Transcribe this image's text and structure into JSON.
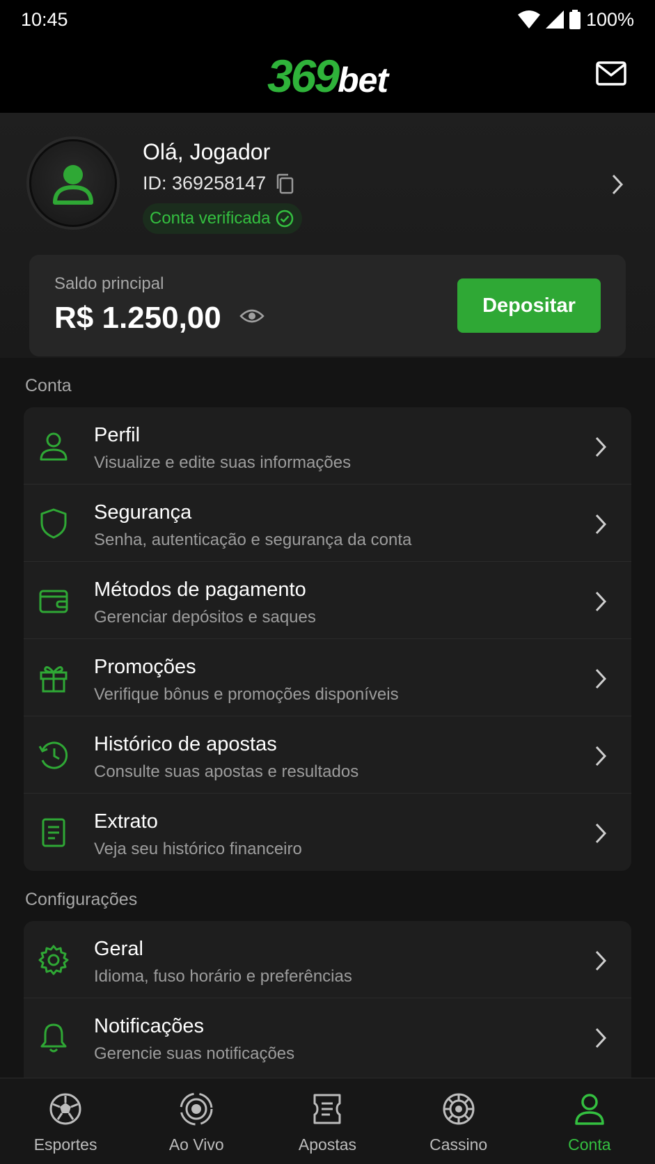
{
  "status_bar": {
    "time": "10:45",
    "battery": "100%"
  },
  "header": {
    "logo_number": "369",
    "logo_word": "bet",
    "icon": "mail-icon"
  },
  "profile": {
    "greeting": "Olá, Jogador",
    "user_id": "ID: 369258147",
    "verified": "Conta verificada"
  },
  "balance": {
    "label": "Saldo principal",
    "value": "R$ 1.250,00",
    "deposit_label": "Depositar"
  },
  "sections": {
    "account_title": "Conta",
    "settings_title": "Configurações"
  },
  "account_items": [
    {
      "label": "Perfil",
      "sub": "Visualize e edite suas informações",
      "icon": "user-icon"
    },
    {
      "label": "Segurança",
      "sub": "Senha, autenticação e segurança da conta",
      "icon": "shield-icon"
    },
    {
      "label": "Métodos de pagamento",
      "sub": "Gerenciar depósitos e saques",
      "icon": "wallet-icon"
    },
    {
      "label": "Promoções",
      "sub": "Verifique bônus e promoções disponíveis",
      "icon": "gift-icon"
    },
    {
      "label": "Histórico de apostas",
      "sub": "Consulte suas apostas e resultados",
      "icon": "history-icon"
    },
    {
      "label": "Extrato",
      "sub": "Veja seu histórico financeiro",
      "icon": "document-icon"
    }
  ],
  "settings_items": [
    {
      "label": "Geral",
      "sub": "Idioma, fuso horário e preferências",
      "icon": "gear-icon"
    },
    {
      "label": "Notificações",
      "sub": "Gerencie suas notificações",
      "icon": "bell-icon"
    }
  ],
  "bottom_nav": [
    {
      "label": "Esportes",
      "icon": "soccer-ball-icon"
    },
    {
      "label": "Ao Vivo",
      "icon": "live-broadcast-icon"
    },
    {
      "label": "Apostas",
      "icon": "betslip-icon"
    },
    {
      "label": "Cassino",
      "icon": "casino-chip-icon"
    },
    {
      "label": "Conta",
      "icon": "account-icon",
      "active": true
    }
  ],
  "colors": {
    "accent": "#2fa835",
    "background": "#141414",
    "card": "#1e1e1e"
  }
}
